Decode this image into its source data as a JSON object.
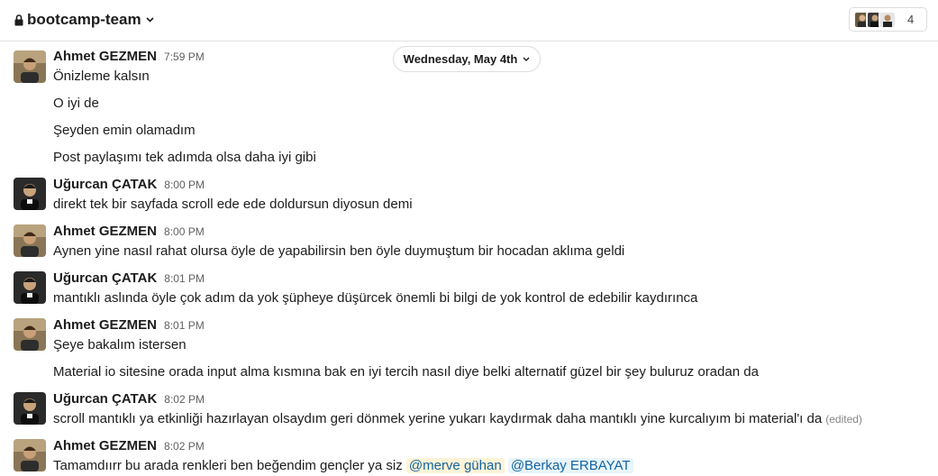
{
  "channel": {
    "name": "bootcamp-team",
    "member_count": "4"
  },
  "date_divider": "Wednesday, May 4th",
  "messages": [
    {
      "author": "Ahmet GEZMEN",
      "time": "7:59 PM",
      "lines": [
        "Önizleme kalsın",
        "O iyi de",
        "Şeyden emin olamadım",
        "Post paylaşımı tek adımda olsa daha iyi gibi"
      ]
    },
    {
      "author": "Uğurcan ÇATAK",
      "time": "8:00 PM",
      "lines": [
        "direkt tek bir sayfada scroll ede ede doldursun diyosun demi"
      ]
    },
    {
      "author": "Ahmet GEZMEN",
      "time": "8:00 PM",
      "lines": [
        "Aynen yine nasıl rahat olursa öyle de yapabilirsin ben öyle duymuştum bir hocadan aklıma geldi"
      ]
    },
    {
      "author": "Uğurcan ÇATAK",
      "time": "8:01 PM",
      "lines": [
        "mantıklı aslında öyle çok adım da yok şüpheye düşürcek önemli bi bilgi de yok kontrol de edebilir kaydırınca"
      ]
    },
    {
      "author": "Ahmet GEZMEN",
      "time": "8:01 PM",
      "lines": [
        "Şeye bakalım istersen",
        "Material io sitesine orada input alma kısmına bak en iyi tercih nasıl diye belki alternatif güzel bir şey buluruz oradan da"
      ]
    },
    {
      "author": "Uğurcan ÇATAK",
      "time": "8:02 PM",
      "lines": [
        "scroll mantıklı ya etkinliği hazırlayan olsaydım geri dönmek yerine yukarı kaydırmak daha mantıklı yine kurcalıyım bi material'ı da"
      ],
      "edited": "(edited)"
    },
    {
      "author": "Ahmet GEZMEN",
      "time": "8:02 PM",
      "lines": [
        "Tamamdıırr bu arada renkleri ben beğendim gençler ya siz"
      ],
      "mentions": [
        "@merve gühan",
        "@Berkay ERBAYAT"
      ]
    }
  ],
  "colors": {
    "mention_text": "#1264a3",
    "mention_bg": "#e8f5fa",
    "mention_self_bg": "#fdf3d6"
  },
  "icons": {
    "channel": "lock-icon",
    "dropdown": "chevron-down-icon"
  }
}
